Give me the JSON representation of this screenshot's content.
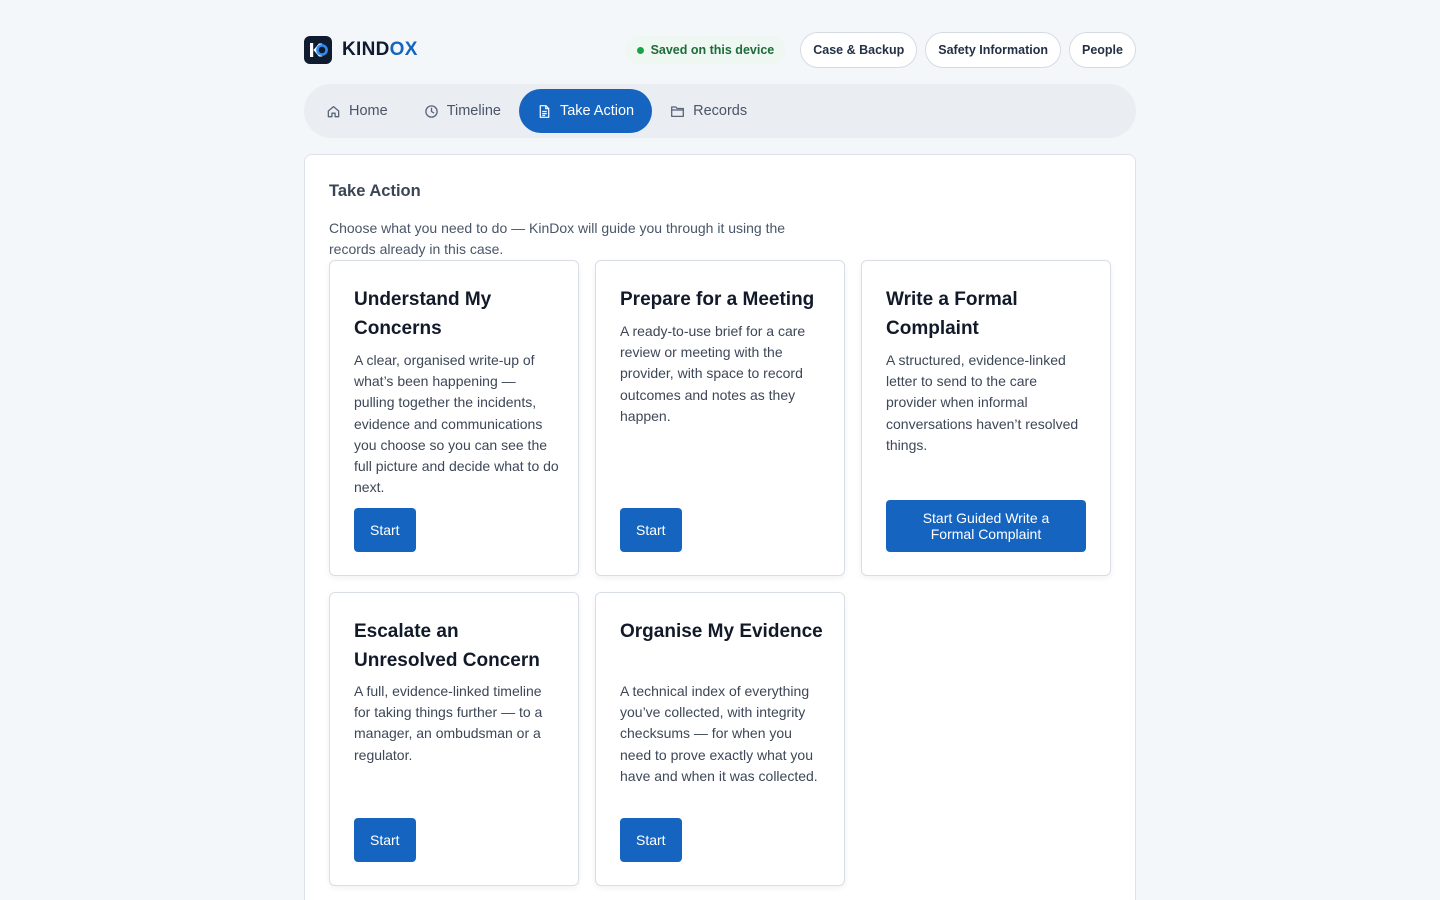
{
  "brand": {
    "name_prefix": "KIND",
    "name_suffix": "OX",
    "logo_letters": "K"
  },
  "header": {
    "saved_status": "Saved on this device",
    "buttons": [
      "Case & Backup",
      "Safety Information",
      "People"
    ]
  },
  "nav": {
    "tabs": [
      {
        "label": "Home",
        "icon": "home-icon",
        "active": false
      },
      {
        "label": "Timeline",
        "icon": "clock-icon",
        "active": false
      },
      {
        "label": "Take Action",
        "icon": "document-icon",
        "active": true
      },
      {
        "label": "Records",
        "icon": "folder-icon",
        "active": false
      }
    ]
  },
  "main": {
    "title": "Take Action",
    "description": "Choose what you need to do — KinDox will guide you through it using the records already in this case.",
    "cards": [
      {
        "title": "Understand My Concerns",
        "description": "A clear, organised write-up of what’s been happening — pulling together the incidents, evidence and communications you choose so you can see the full picture and decide what to do next.",
        "button": "Start"
      },
      {
        "title": "Prepare for a Meeting",
        "description": "A ready-to-use brief for a care review or meeting with the provider, with space to record outcomes and notes as they happen.",
        "button": "Start"
      },
      {
        "title": "Write a Formal Complaint",
        "description": "A structured, evidence-linked letter to send to the care provider when informal conversations haven’t resolved things.",
        "button": "Start Guided Write a Formal Complaint"
      },
      {
        "title": "Escalate an Unresolved Concern",
        "description": "A full, evidence-linked timeline for taking things further — to a manager, an ombudsman or a regulator.",
        "button": "Start"
      },
      {
        "title": "Organise My Evidence",
        "description": "A technical index of everything you’ve collected, with integrity checksums — for when you need to prove exactly what you have and when it was collected.",
        "button": "Start"
      }
    ]
  },
  "colors": {
    "accent": "#1565c0",
    "saved_dot": "#19a24a",
    "background": "#f4f7fa"
  }
}
